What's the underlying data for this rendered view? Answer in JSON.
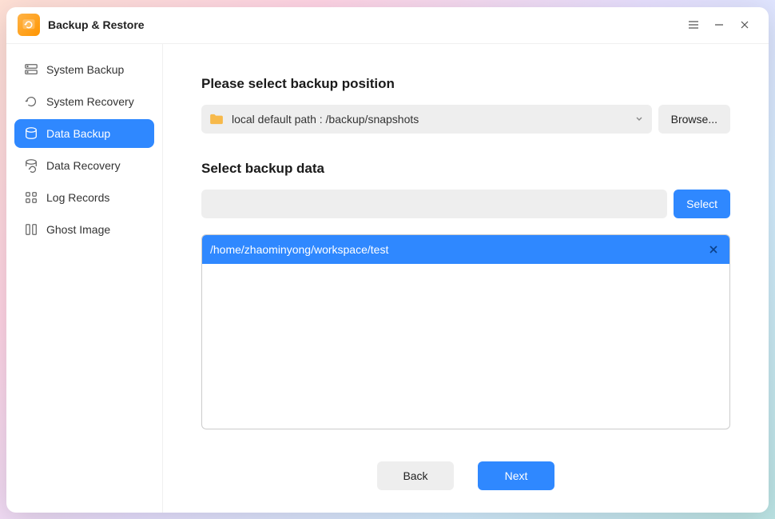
{
  "app": {
    "title": "Backup & Restore"
  },
  "sidebar": {
    "items": [
      {
        "label": "System Backup"
      },
      {
        "label": "System Recovery"
      },
      {
        "label": "Data Backup"
      },
      {
        "label": "Data Recovery"
      },
      {
        "label": "Log Records"
      },
      {
        "label": "Ghost Image"
      }
    ],
    "active_index": 2
  },
  "main": {
    "position_label": "Please select backup position",
    "position_value": "local default path : /backup/snapshots",
    "browse_label": "Browse...",
    "data_label": "Select backup data",
    "select_label": "Select",
    "selected_paths": [
      "/home/zhaominyong/workspace/test"
    ],
    "back_label": "Back",
    "next_label": "Next"
  },
  "colors": {
    "accent": "#2f88ff"
  }
}
